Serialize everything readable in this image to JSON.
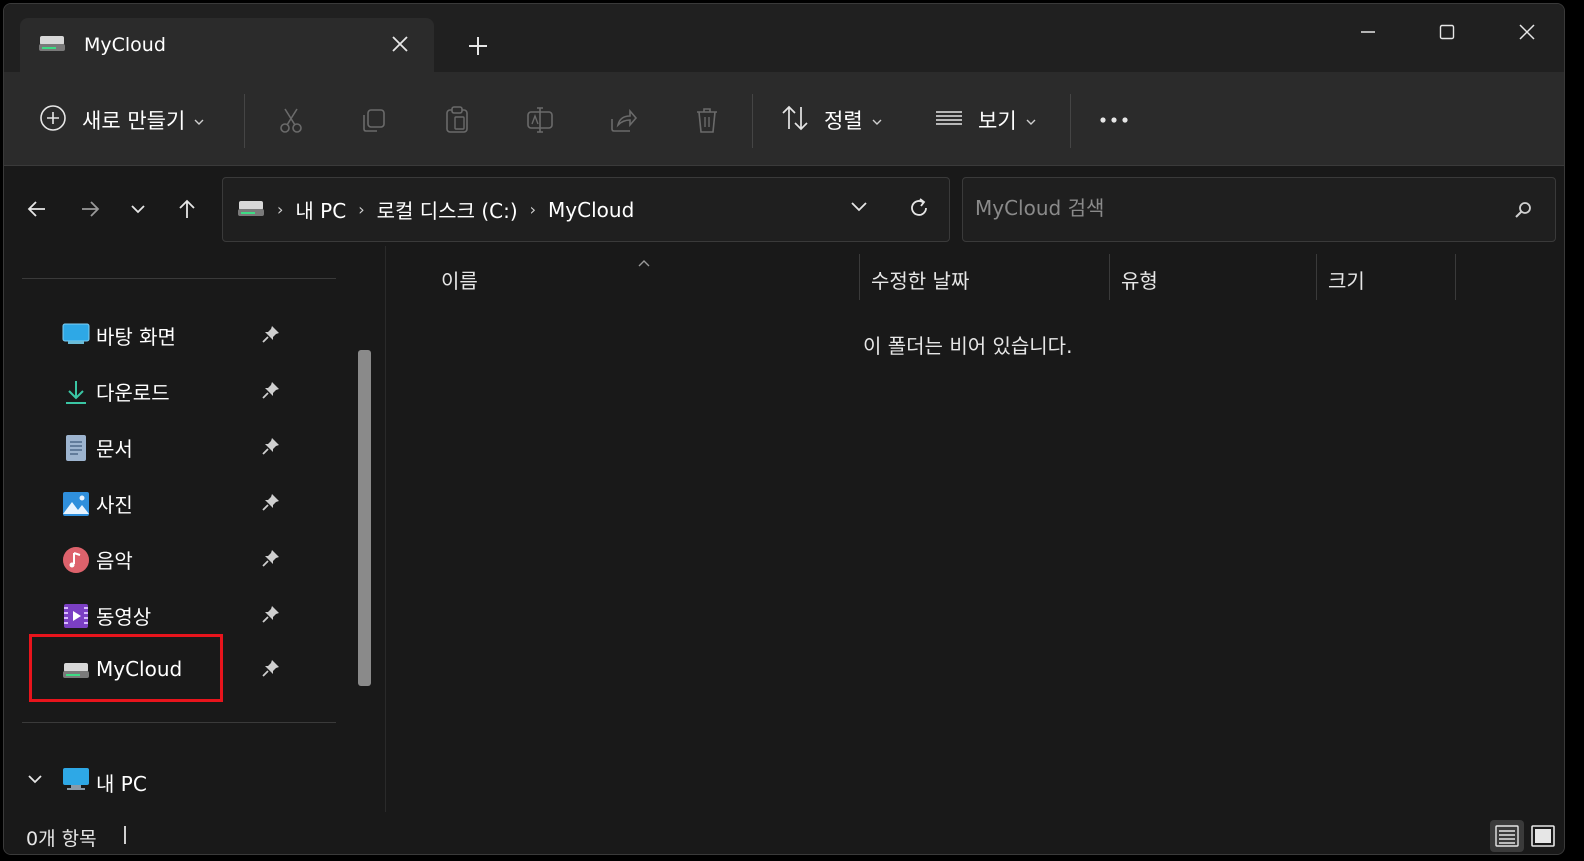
{
  "window": {
    "tab_title": "MyCloud"
  },
  "toolbar": {
    "new_label": "새로 만들기",
    "sort_label": "정렬",
    "view_label": "보기"
  },
  "address": {
    "crumbs": [
      "내 PC",
      "로컬 디스크 (C:)",
      "MyCloud"
    ]
  },
  "search": {
    "placeholder": "MyCloud 검색"
  },
  "sidebar": {
    "items": [
      {
        "label": "바탕 화면",
        "icon": "desktop-icon"
      },
      {
        "label": "다운로드",
        "icon": "download-icon"
      },
      {
        "label": "문서",
        "icon": "document-icon"
      },
      {
        "label": "사진",
        "icon": "pictures-icon"
      },
      {
        "label": "음악",
        "icon": "music-icon"
      },
      {
        "label": "동영상",
        "icon": "video-icon"
      },
      {
        "label": "MyCloud",
        "icon": "drive-icon"
      }
    ],
    "this_pc": "내 PC"
  },
  "content": {
    "columns": [
      "이름",
      "수정한 날짜",
      "유형",
      "크기"
    ],
    "empty_message": "이 폴더는 비어 있습니다."
  },
  "status": {
    "item_count": "0개 항목"
  },
  "colors": {
    "highlight": "#e8141c",
    "background": "#191919",
    "toolbar": "#2b2b2b"
  }
}
